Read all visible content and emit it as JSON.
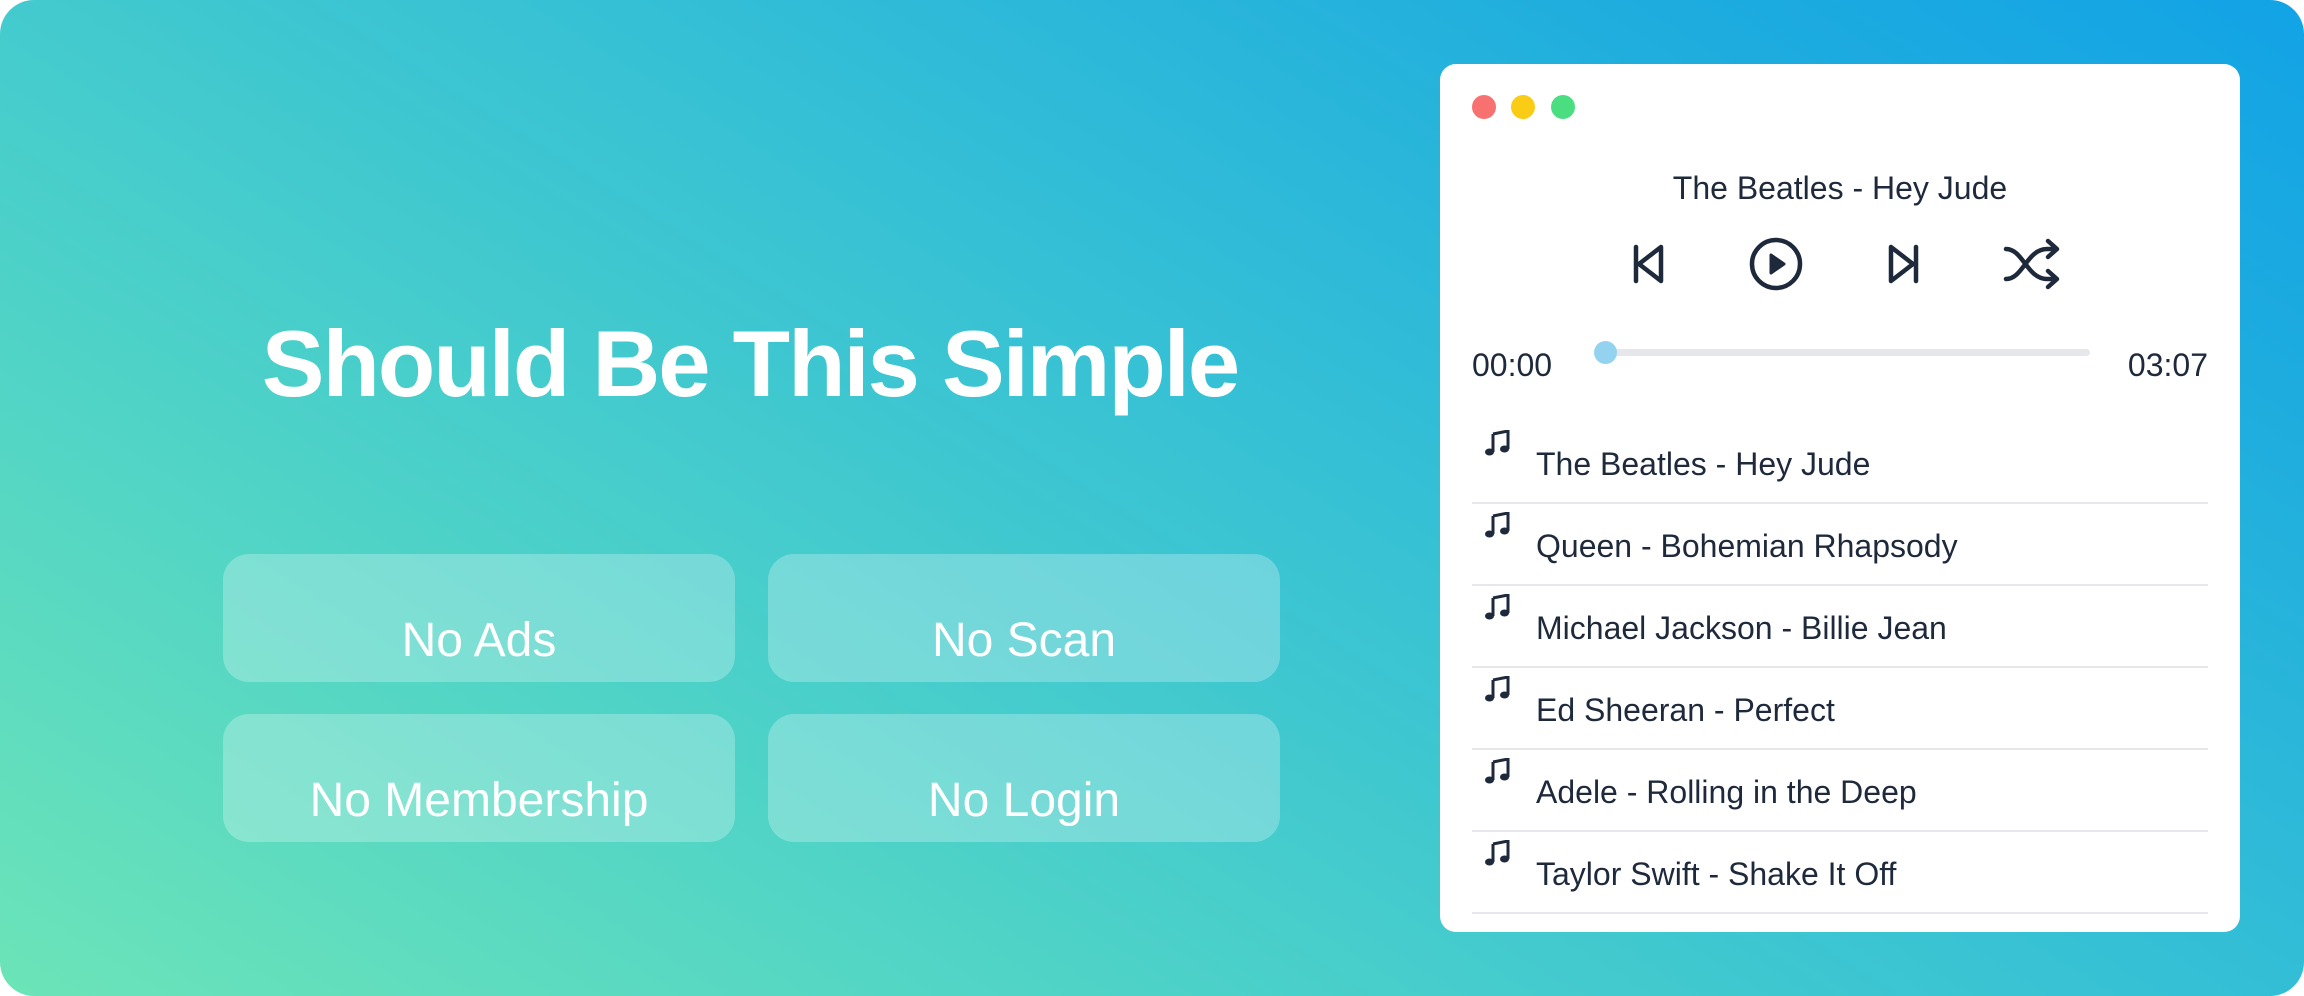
{
  "headline": "Should Be This Simple",
  "features": [
    "No Ads",
    "No Scan",
    "No Membership",
    "No Login"
  ],
  "player": {
    "window_controls": [
      "close-dot",
      "minimize-dot",
      "maximize-dot"
    ],
    "now_playing": "The Beatles - Hey Jude",
    "controls": [
      "skip-back-icon",
      "play-icon",
      "skip-forward-icon",
      "shuffle-icon"
    ],
    "time_elapsed": "00:00",
    "time_total": "03:07",
    "progress": 0.0,
    "playlist": [
      "The Beatles - Hey Jude",
      "Queen - Bohemian Rhapsody",
      "Michael Jackson - Billie Jean",
      "Ed Sheeran - Perfect",
      "Adele - Rolling in the Deep",
      "Taylor Swift - Shake It Off"
    ]
  },
  "colors": {
    "gradient_start": "#6ce4b8",
    "gradient_end": "#12a3e6",
    "text_dark": "#1e293b",
    "progress": "#93d3ef",
    "close": "#f87171",
    "minimize": "#facc15",
    "maximize": "#4ade80"
  }
}
